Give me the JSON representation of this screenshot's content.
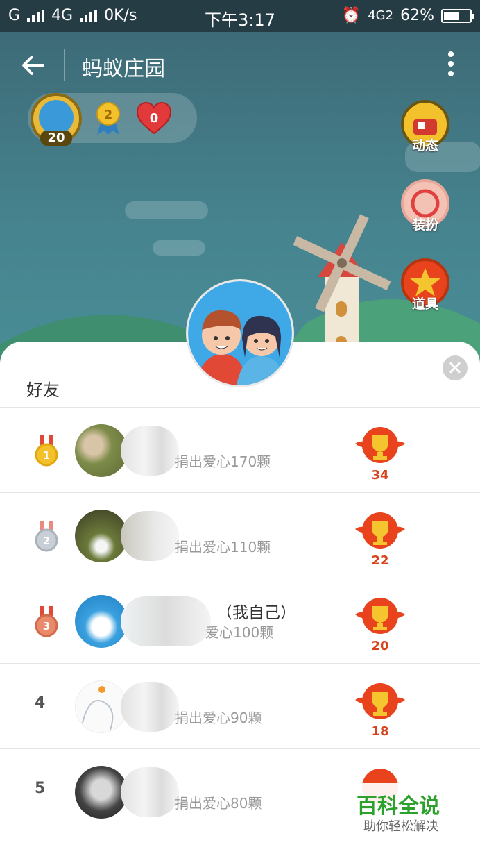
{
  "status_bar": {
    "carrier_left": "G",
    "net_type": "4G",
    "speed": "0K/s",
    "time": "下午3:17",
    "net_right": "4G2",
    "battery": "62%",
    "battery_level": 0.62
  },
  "header": {
    "title": "蚂蚁庄园"
  },
  "stats": {
    "level": "20",
    "medal_count": "2",
    "heart_count": "0"
  },
  "side_buttons": [
    {
      "label": "动态"
    },
    {
      "label": "装扮"
    },
    {
      "label": "道具"
    }
  ],
  "panel": {
    "section_title": "好友"
  },
  "friends": [
    {
      "rank": "1",
      "name_suffix": "",
      "sub_text": "捐出爱心170颗",
      "trophy_count": "34"
    },
    {
      "rank": "2",
      "name_suffix": "",
      "sub_text": "捐出爱心110颗",
      "trophy_count": "22"
    },
    {
      "rank": "3",
      "name_suffix": "（我自己）",
      "sub_text": "爱心100颗",
      "trophy_count": "20"
    },
    {
      "rank": "4",
      "name_suffix": "",
      "sub_text": "捐出爱心90颗",
      "trophy_count": "18"
    },
    {
      "rank": "5",
      "name_suffix": "",
      "sub_text": "捐出爱心80颗",
      "trophy_count": ""
    }
  ],
  "watermark": {
    "title": "百科全说",
    "subtitle": "助你轻松解决"
  },
  "colors": {
    "accent_red": "#e8431d",
    "gold": "#f3c12b",
    "panel_bg": "#ffffff"
  }
}
